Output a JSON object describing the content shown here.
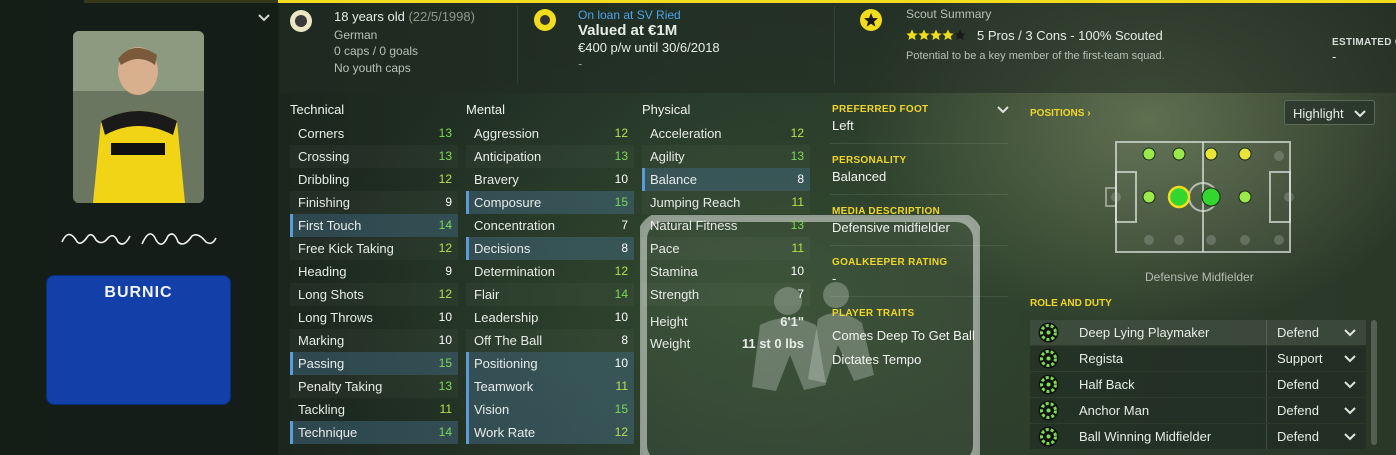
{
  "player": {
    "shirt_name": "BURNIC"
  },
  "topbar": {
    "age": "18 years old",
    "dob": "(22/5/1998)",
    "nationality": "German",
    "caps": "0 caps / 0 goals",
    "youth_caps": "No youth caps",
    "loan": "On loan at SV Ried",
    "value": "Valued at €1M",
    "wage": "€400 p/w until 30/6/2018",
    "dash": "-",
    "scout_title": "Scout Summary",
    "stars": 4,
    "stars_max": 5,
    "scout_result": "5 Pros / 3 Cons - 100% Scouted",
    "scout_note": "Potential to be a key member of the first-team squad.",
    "estimated_label": "ESTIMATED C",
    "estimated_value": "-"
  },
  "technical": {
    "header": "Technical",
    "rows": [
      {
        "label": "Corners",
        "value": "13"
      },
      {
        "label": "Crossing",
        "value": "13"
      },
      {
        "label": "Dribbling",
        "value": "12"
      },
      {
        "label": "Finishing",
        "value": "9"
      },
      {
        "label": "First Touch",
        "value": "14"
      },
      {
        "label": "Free Kick Taking",
        "value": "12"
      },
      {
        "label": "Heading",
        "value": "9"
      },
      {
        "label": "Long Shots",
        "value": "12"
      },
      {
        "label": "Long Throws",
        "value": "10"
      },
      {
        "label": "Marking",
        "value": "10"
      },
      {
        "label": "Passing",
        "value": "15"
      },
      {
        "label": "Penalty Taking",
        "value": "13"
      },
      {
        "label": "Tackling",
        "value": "11"
      },
      {
        "label": "Technique",
        "value": "14"
      }
    ]
  },
  "mental": {
    "header": "Mental",
    "rows": [
      {
        "label": "Aggression",
        "value": "12"
      },
      {
        "label": "Anticipation",
        "value": "13"
      },
      {
        "label": "Bravery",
        "value": "10"
      },
      {
        "label": "Composure",
        "value": "15"
      },
      {
        "label": "Concentration",
        "value": "7"
      },
      {
        "label": "Decisions",
        "value": "8"
      },
      {
        "label": "Determination",
        "value": "12"
      },
      {
        "label": "Flair",
        "value": "14"
      },
      {
        "label": "Leadership",
        "value": "10"
      },
      {
        "label": "Off The Ball",
        "value": "8"
      },
      {
        "label": "Positioning",
        "value": "10"
      },
      {
        "label": "Teamwork",
        "value": "11"
      },
      {
        "label": "Vision",
        "value": "15"
      },
      {
        "label": "Work Rate",
        "value": "12"
      }
    ]
  },
  "physical": {
    "header": "Physical",
    "rows": [
      {
        "label": "Acceleration",
        "value": "12"
      },
      {
        "label": "Agility",
        "value": "13"
      },
      {
        "label": "Balance",
        "value": "8"
      },
      {
        "label": "Jumping Reach",
        "value": "11"
      },
      {
        "label": "Natural Fitness",
        "value": "13"
      },
      {
        "label": "Pace",
        "value": "11"
      },
      {
        "label": "Stamina",
        "value": "10"
      },
      {
        "label": "Strength",
        "value": "7"
      }
    ],
    "height_label": "Height",
    "height_value": "6'1\"",
    "weight_label": "Weight",
    "weight_value": "11 st 0 lbs"
  },
  "details": {
    "foot_label": "PREFERRED FOOT",
    "foot_value": "Left",
    "personality_label": "PERSONALITY",
    "personality_value": "Balanced",
    "media_label": "MEDIA DESCRIPTION",
    "media_value": "Defensive midfielder",
    "gk_label": "GOALKEEPER RATING",
    "gk_value": "-",
    "traits_label": "PLAYER TRAITS",
    "traits": [
      "Comes Deep To Get Ball",
      "Dictates Tempo"
    ]
  },
  "positions": {
    "header": "POSITIONS ›",
    "highlight_label": "Highlight",
    "position_name": "Defensive Midfielder"
  },
  "roles": {
    "header": "ROLE AND DUTY",
    "rows": [
      {
        "role": "Deep Lying Playmaker",
        "duty": "Defend"
      },
      {
        "role": "Regista",
        "duty": "Support"
      },
      {
        "role": "Half Back",
        "duty": "Defend"
      },
      {
        "role": "Anchor Man",
        "duty": "Defend"
      },
      {
        "role": "Ball Winning Midfielder",
        "duty": "Defend"
      }
    ]
  },
  "colors": {
    "accent": "#f1dc1d",
    "high_value": "#7ed957",
    "highlight_row": "#466e8c"
  }
}
